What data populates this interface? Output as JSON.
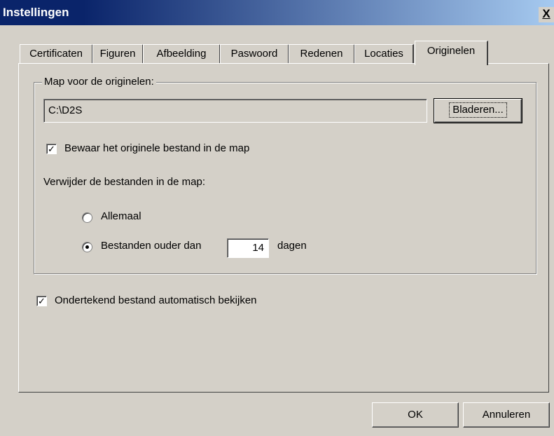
{
  "window": {
    "title": "Instellingen",
    "close_label": "X"
  },
  "tabs": [
    {
      "label": "Certificaten",
      "active": false
    },
    {
      "label": "Figuren",
      "active": false
    },
    {
      "label": "Afbeelding",
      "active": false
    },
    {
      "label": "Paswoord",
      "active": false
    },
    {
      "label": "Redenen",
      "active": false
    },
    {
      "label": "Locaties",
      "active": false
    },
    {
      "label": "Originelen",
      "active": true
    }
  ],
  "originals": {
    "group_label": "Map voor de originelen:",
    "folder_path": "C:\\D2S",
    "browse_label": "Bladeren...",
    "keep_original_label": "Bewaar het originele bestand in de map",
    "keep_original_checked": true,
    "delete_label": "Verwijder de bestanden in de map:",
    "option_all_label": "Allemaal",
    "option_older_label": "Bestanden ouder dan",
    "days_value": "14",
    "days_unit": "dagen",
    "selected_option": "older"
  },
  "auto_view": {
    "label": "Ondertekend bestand automatisch bekijken",
    "checked": true
  },
  "footer": {
    "ok_label": "OK",
    "cancel_label": "Annuleren"
  },
  "colors": {
    "titlebar_start": "#0a246a",
    "titlebar_end": "#a6caf0",
    "dialog_bg": "#d4d0c8"
  }
}
